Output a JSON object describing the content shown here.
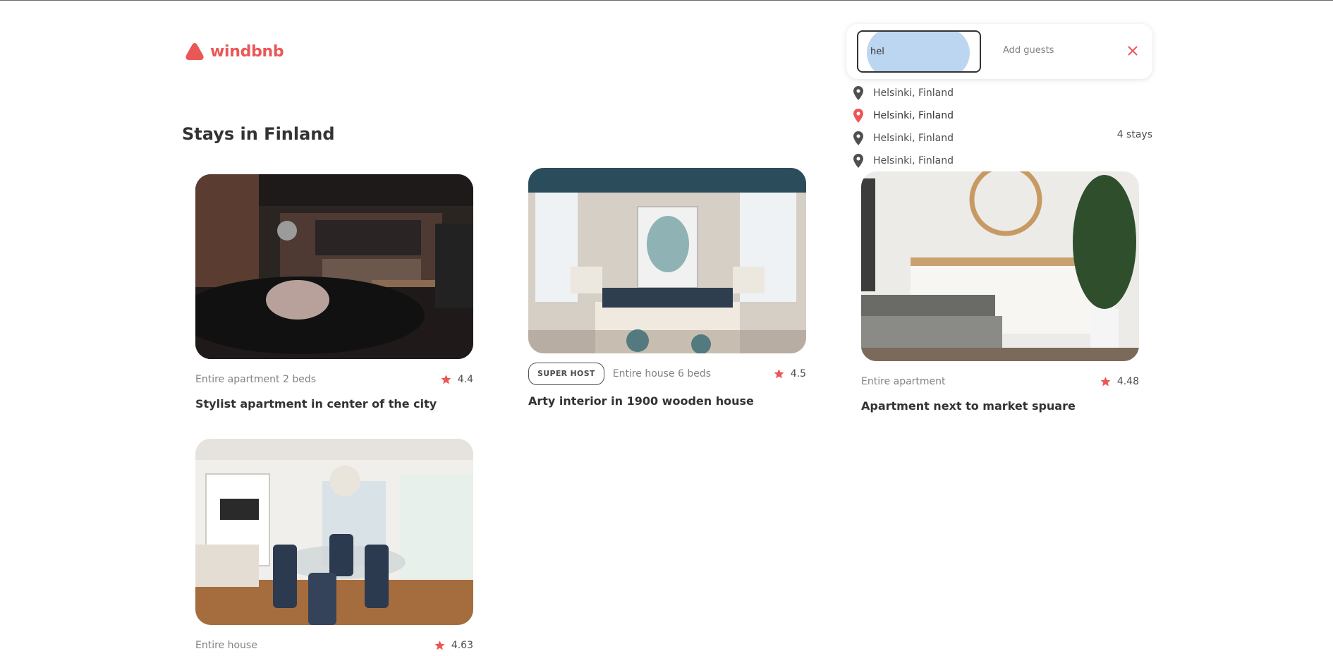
{
  "brand": {
    "name": "windbnb",
    "color": "#eb5757",
    "logo_icon": "brand-triangle-icon"
  },
  "page": {
    "title": "Stays in Finland",
    "count_label": "4 stays"
  },
  "search": {
    "location_value": "hel",
    "guests_placeholder": "Add guests",
    "clear_icon": "close-icon",
    "suggestions": [
      {
        "label": "Helsinki, Finland",
        "icon": "location-pin-icon",
        "active": false
      },
      {
        "label": "Helsinki, Finland",
        "icon": "location-pin-icon",
        "active": true
      },
      {
        "label": "Helsinki, Finland",
        "icon": "location-pin-icon",
        "active": false
      },
      {
        "label": "Helsinki, Finland",
        "icon": "location-pin-icon",
        "active": false
      }
    ]
  },
  "stays": [
    {
      "superhost": false,
      "type": "Entire apartment 2 beds",
      "rating": "4.4",
      "title": "Stylist apartment in center of the city"
    },
    {
      "superhost": true,
      "superhost_label": "SUPER HOST",
      "type": "Entire house 6 beds",
      "rating": "4.5",
      "title": "Arty interior in 1900 wooden house"
    },
    {
      "superhost": false,
      "type": "Entire apartment",
      "rating": "4.48",
      "title": "Apartment next to market spuare"
    },
    {
      "superhost": false,
      "type": "Entire house",
      "rating": "4.63",
      "title": ""
    }
  ],
  "colors": {
    "accent": "#eb5757",
    "text": "#333333",
    "muted": "#828282",
    "highlight": "#bcd6f2"
  }
}
